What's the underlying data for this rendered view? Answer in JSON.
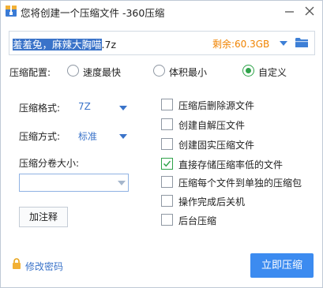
{
  "window": {
    "title": "您将创建一个压缩文件 -360压缩",
    "icon": "archive-icon",
    "minimize_icon": "minimize-icon",
    "close_icon": "close-icon"
  },
  "path": {
    "selected_text": "羞羞兔，麻辣大胸喵",
    "rest_text": ".7z",
    "remaining_label": "剩余:60.3GB",
    "remaining_color": "#f08300",
    "dropdown_icon": "chevron-down-icon",
    "browse_icon": "folder-icon"
  },
  "config": {
    "label": "压缩配置:",
    "options": [
      {
        "label": "速度最快",
        "selected": false
      },
      {
        "label": "体积最小",
        "selected": false
      },
      {
        "label": "自定义",
        "selected": true
      }
    ]
  },
  "settings": {
    "format_label": "压缩格式:",
    "format_value": "7Z",
    "method_label": "压缩方式:",
    "method_value": "标准",
    "volume_label": "压缩分卷大小:",
    "volume_value": "",
    "note_button": "加注释"
  },
  "options": [
    {
      "label": "压缩后删除源文件",
      "checked": false
    },
    {
      "label": "创建自解压文件",
      "checked": false
    },
    {
      "label": "创建固实压缩文件",
      "checked": false
    },
    {
      "label": "直接存储压缩率低的文件",
      "checked": true
    },
    {
      "label": "压缩每个文件到单独的压缩包",
      "checked": false
    },
    {
      "label": "操作完成后关机",
      "checked": false
    },
    {
      "label": "后台压缩",
      "checked": false
    }
  ],
  "footer": {
    "lock_icon": "lock-icon",
    "password_link": "修改密码",
    "start_button": "立即压缩"
  },
  "colors": {
    "accent": "#3c8bf0",
    "link": "#3a73c9",
    "check_green": "#2fa34a"
  }
}
